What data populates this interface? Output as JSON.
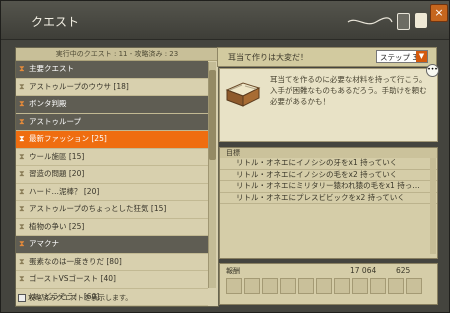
{
  "window": {
    "title": "クエスト"
  },
  "quest_list": {
    "header": "実行中のクエスト : 11 - 攻略済み : 23",
    "rows": [
      {
        "label": "主要クエスト",
        "kind": "category"
      },
      {
        "label": "アストゥループのウウサ [18]",
        "kind": "quest"
      },
      {
        "label": "ボンタ判殿",
        "kind": "category"
      },
      {
        "label": "アストゥループ",
        "kind": "category"
      },
      {
        "label": "最新ファッション [25]",
        "kind": "selected"
      },
      {
        "label": "ウール施區 [15]",
        "kind": "quest"
      },
      {
        "label": "習造の問題 [20]",
        "kind": "quest"
      },
      {
        "label": "ハード…泥棒？ [20]",
        "kind": "quest"
      },
      {
        "label": "アストゥループのちょっとした狂気 [15]",
        "kind": "quest"
      },
      {
        "label": "植物の争い [25]",
        "kind": "quest"
      },
      {
        "label": "アマクナ",
        "kind": "category"
      },
      {
        "label": "蛋素なのは一度きりだ [80]",
        "kind": "quest"
      },
      {
        "label": "ゴーストVSゴースト [40]",
        "kind": "quest"
      },
      {
        "label": "はいどうぞう！ [60]",
        "kind": "quest"
      }
    ],
    "footer_checkbox": "攻略済みクエストを表示します。"
  },
  "quest_detail": {
    "title": "耳当て作りは大変だ！",
    "step_select": "ステップ 3",
    "description": "耳当てを作るのに必要な材料を持って行こう。入手が困難なものもあるだろう。手助けを頼む必要があるかも！",
    "goals_header": "目標",
    "goals": [
      "リトル・オネエにイノシシの牙をx1 持っていく",
      "リトル・オネエにイノシシの毛をx2 持っていく",
      "リトル・オネエにミリタリー猿われ猿の毛をx1 持っ…",
      "リトル・オネエにプレスビビックをx2 持っていく"
    ],
    "reward_header": "報酬",
    "reward_xp": "17 064",
    "reward_kamas": "625"
  },
  "colors": {
    "accent": "#ef6d10",
    "category_bg": "#5f5d53",
    "panel_bg": "#d8d0ae"
  }
}
